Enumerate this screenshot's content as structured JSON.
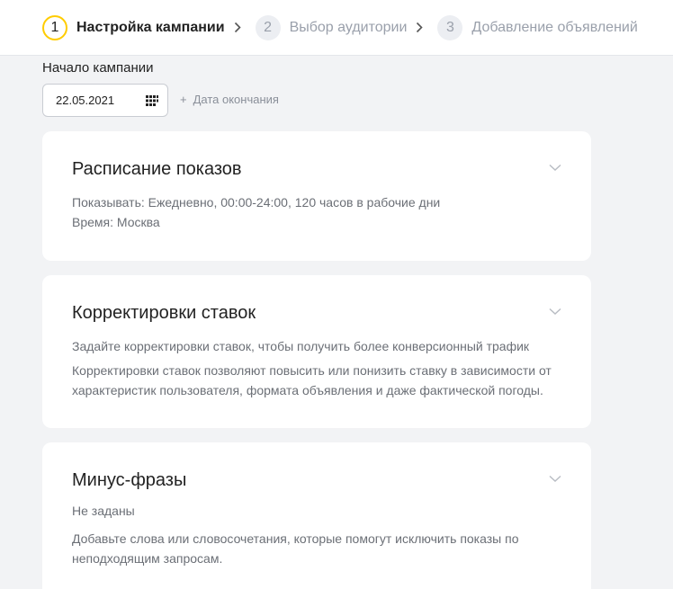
{
  "stepper": {
    "steps": [
      {
        "number": "1",
        "label": "Настройка кампании"
      },
      {
        "number": "2",
        "label": "Выбор аудитории"
      },
      {
        "number": "3",
        "label": "Добавление объявлений"
      }
    ]
  },
  "campaign_start": {
    "label": "Начало кампании",
    "date_value": "22.05.2021",
    "end_date_link": "Дата окончания"
  },
  "cards": [
    {
      "title": "Расписание показов",
      "lines": [
        "Показывать: Ежедневно, 00:00-24:00, 120 часов в рабочие дни",
        "Время: Москва"
      ]
    },
    {
      "title": "Корректировки ставок",
      "lines": [
        "Задайте корректировки ставок, чтобы получить более конверсионный трафик",
        "Корректировки ставок позволяют повысить или понизить ставку в зависимости от характеристик пользователя, формата объявления и даже фактической погоды."
      ]
    },
    {
      "title": "Минус-фразы",
      "lines": [
        "Не заданы",
        "Добавьте слова или словосочетания, которые помогут исключить показы по неподходящим запросам."
      ]
    }
  ],
  "colors": {
    "accent": "#ffcc00",
    "inactive": "#9aa0ab",
    "muted_text": "#6b6f76",
    "background": "#f2f3f5"
  }
}
